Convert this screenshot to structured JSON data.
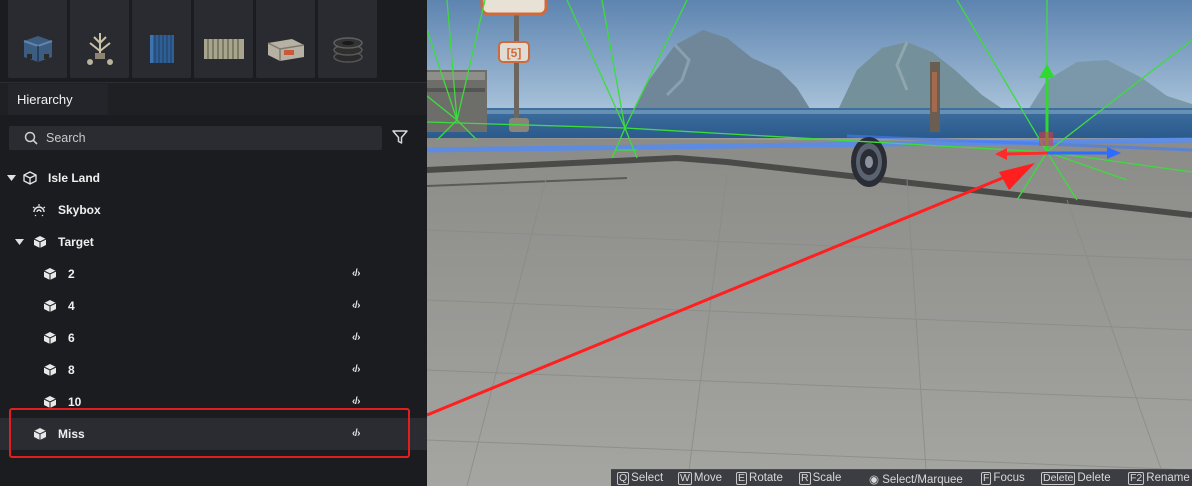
{
  "hierarchy": {
    "tab_label": "Hierarchy",
    "search_placeholder": "Search",
    "items": [
      {
        "label": "Isle Land",
        "script": ""
      },
      {
        "label": "Skybox",
        "script": ""
      },
      {
        "label": "Target",
        "script": ""
      },
      {
        "label": "2",
        "script": "‹/›"
      },
      {
        "label": "4",
        "script": "‹/›"
      },
      {
        "label": "6",
        "script": "‹/›"
      },
      {
        "label": "8",
        "script": "‹/›"
      },
      {
        "label": "10",
        "script": "‹/›"
      },
      {
        "label": "Miss",
        "script": "‹/›"
      }
    ]
  },
  "assets": {
    "icons": [
      "crate-icon",
      "antenna-icon",
      "container-icon",
      "fence-icon",
      "box-icon",
      "tire-stack-icon"
    ]
  },
  "viewport": {
    "sign_label": "[5]",
    "shortcuts": [
      {
        "key": "Q",
        "action": "Select"
      },
      {
        "key": "W",
        "action": "Move"
      },
      {
        "key": "E",
        "action": "Rotate"
      },
      {
        "key": "R",
        "action": "Scale"
      },
      {
        "key": "",
        "action": "Select/Marquee"
      },
      {
        "key": "F",
        "action": "Focus"
      },
      {
        "key": "Delete",
        "action": "Delete"
      },
      {
        "key": "F2",
        "action": "Rename"
      }
    ]
  },
  "colors": {
    "panel_bg": "#1b1c20",
    "selected_row": "#2b2c31",
    "annotation_red": "#e02020",
    "gizmo_green": "#3ddc3d",
    "axis_blue": "#2e6bff"
  }
}
